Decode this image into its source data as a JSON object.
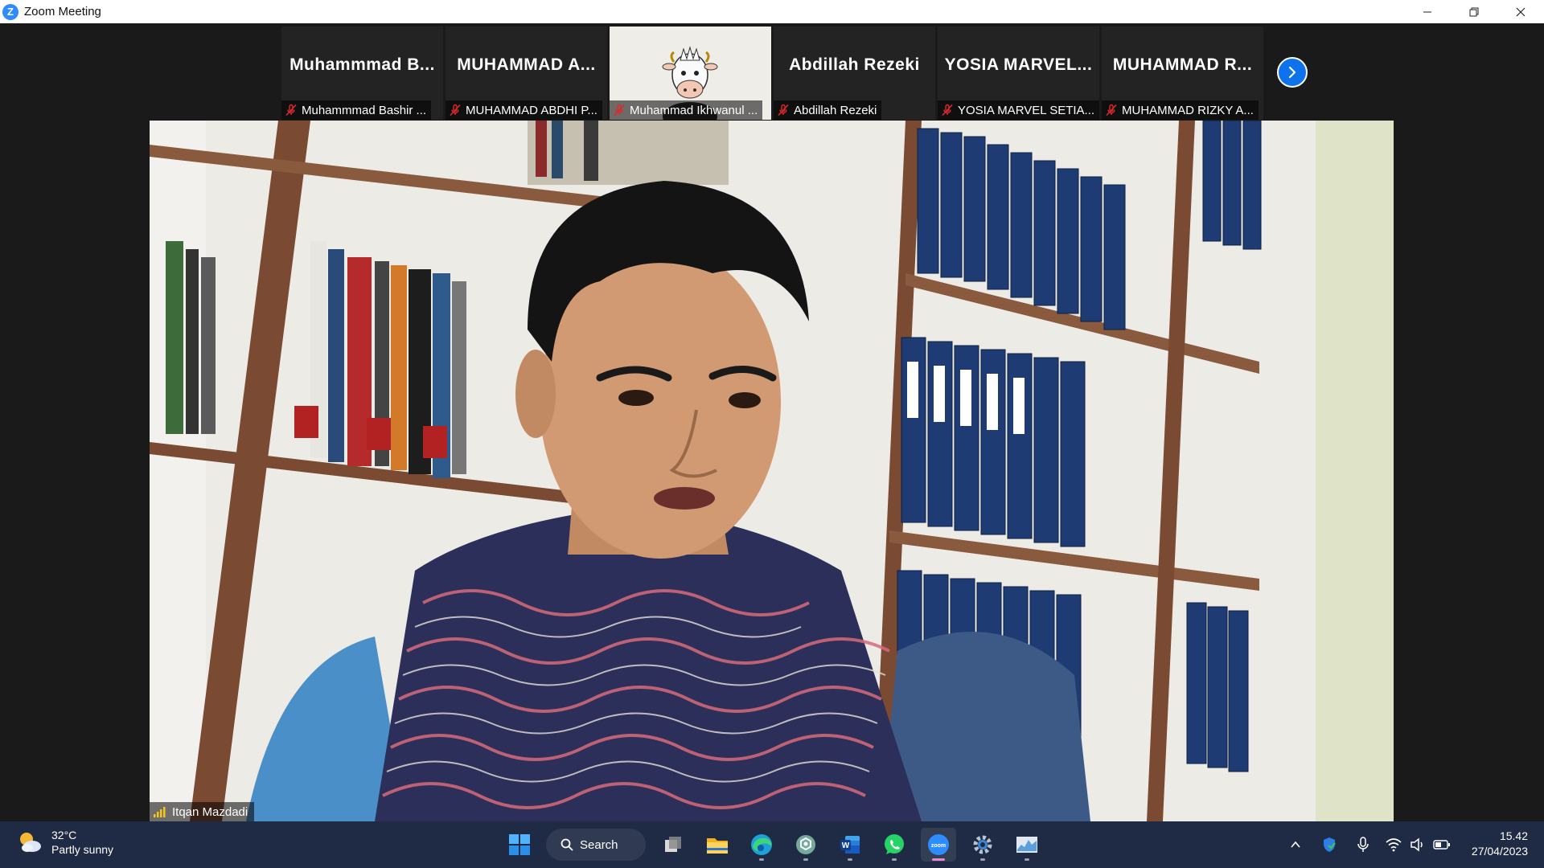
{
  "window": {
    "title": "Zoom Meeting",
    "logo_letter": "Z"
  },
  "participants": [
    {
      "display": "Muhammmad  B...",
      "label": "Muhammmad Bashir ..."
    },
    {
      "display": "MUHAMMAD  A...",
      "label": "MUHAMMAD ABDHI P..."
    },
    {
      "display": "",
      "label": "Muhammad Ikhwanul ..."
    },
    {
      "display": "Abdillah Rezeki",
      "label": "Abdillah Rezeki"
    },
    {
      "display": "YOSIA  MARVEL...",
      "label": "YOSIA MARVEL SETIA..."
    },
    {
      "display": "MUHAMMAD  R...",
      "label": "MUHAMMAD RIZKY A..."
    }
  ],
  "active_speaker": {
    "name": "Itqan Mazdadi"
  },
  "taskbar": {
    "weather_temp": "32°C",
    "weather_condition": "Partly sunny",
    "search_label": "Search",
    "time": "15.42",
    "date": "27/04/2023",
    "pinned_apps": [
      "windows-start-icon",
      "search",
      "task-view-icon",
      "file-explorer-icon",
      "edge-icon",
      "chatgpt-icon",
      "word-icon",
      "whatsapp-icon",
      "zoom-icon",
      "settings-icon",
      "task-manager-icon"
    ]
  },
  "colors": {
    "zoom_blue": "#2d8cff",
    "muted_red": "#e02828",
    "taskbar_bg": "#1f2a44",
    "meeting_bg": "#1a1a1a"
  }
}
